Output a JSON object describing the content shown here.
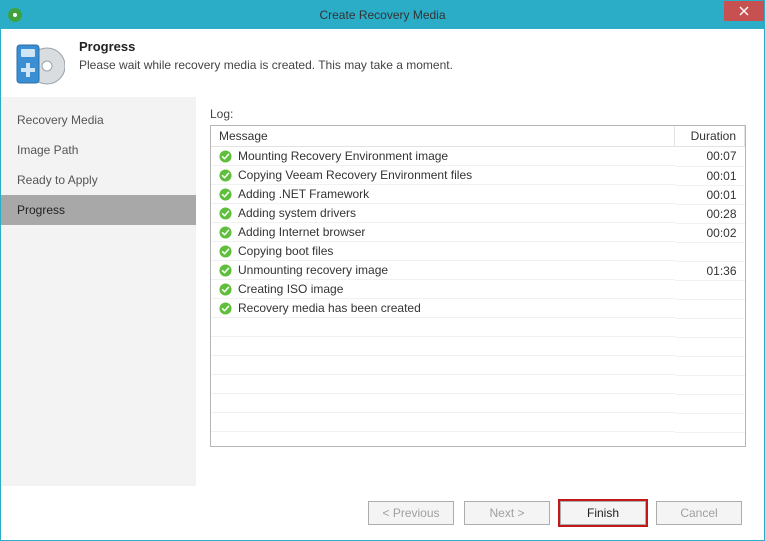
{
  "window": {
    "title": "Create Recovery Media"
  },
  "header": {
    "heading": "Progress",
    "subtext": "Please wait while recovery media is created. This may take a moment."
  },
  "sidebar": {
    "items": [
      {
        "label": "Recovery Media",
        "active": false
      },
      {
        "label": "Image Path",
        "active": false
      },
      {
        "label": "Ready to Apply",
        "active": false
      },
      {
        "label": "Progress",
        "active": true
      }
    ]
  },
  "log": {
    "label": "Log:",
    "columns": {
      "message": "Message",
      "duration": "Duration"
    },
    "rows": [
      {
        "message": "Mounting Recovery Environment image",
        "duration": "00:07"
      },
      {
        "message": "Copying Veeam Recovery Environment files",
        "duration": "00:01"
      },
      {
        "message": "Adding .NET Framework",
        "duration": "00:01"
      },
      {
        "message": "Adding system drivers",
        "duration": "00:28"
      },
      {
        "message": "Adding Internet browser",
        "duration": "00:02"
      },
      {
        "message": "Copying boot files",
        "duration": ""
      },
      {
        "message": "Unmounting recovery image",
        "duration": "01:36"
      },
      {
        "message": "Creating ISO image",
        "duration": ""
      },
      {
        "message": "Recovery media has been created",
        "duration": ""
      }
    ]
  },
  "buttons": {
    "previous": "< Previous",
    "next": "Next >",
    "finish": "Finish",
    "cancel": "Cancel"
  }
}
